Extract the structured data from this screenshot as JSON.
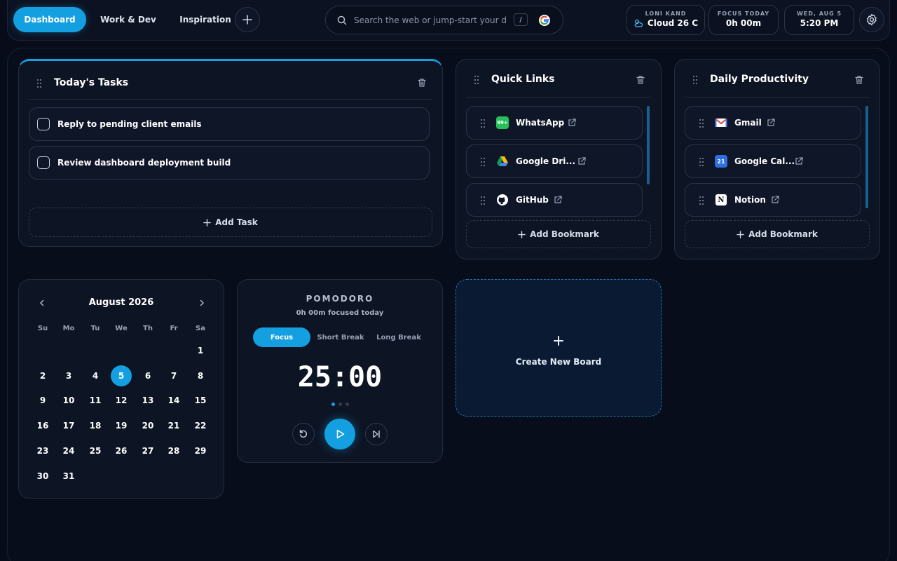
{
  "nav": {
    "tabs": [
      {
        "label": "Dashboard",
        "active": true
      },
      {
        "label": "Work & Dev",
        "active": false
      },
      {
        "label": "Inspiration",
        "active": false
      }
    ],
    "add_icon": "plus-icon"
  },
  "search": {
    "placeholder": "Search the web or jump-start your day",
    "shortcut": "/",
    "engine_icon": "google-icon"
  },
  "stats": {
    "weather": {
      "label": "LONI KAND",
      "value": "Cloud 26 C",
      "icon": "cloud-sun-icon"
    },
    "focus": {
      "label": "FOCUS TODAY",
      "value": "0h 00m"
    },
    "date": {
      "label": "WED, AUG 5",
      "value": "5:20 PM"
    }
  },
  "tasks": {
    "title": "Today's Tasks",
    "items": [
      {
        "text": "Reply to pending client emails",
        "done": false
      },
      {
        "text": "Review dashboard deployment build",
        "done": false
      }
    ],
    "add_label": "Add Task"
  },
  "quick_links": {
    "title": "Quick Links",
    "items": [
      {
        "name": "WhatsApp",
        "badge": "99+",
        "icon": "whatsapp-icon"
      },
      {
        "name": "Google Dri...",
        "icon": "google-drive-icon"
      },
      {
        "name": "GitHub",
        "icon": "github-icon"
      }
    ],
    "add_label": "Add Bookmark"
  },
  "daily": {
    "title": "Daily Productivity",
    "items": [
      {
        "name": "Gmail",
        "icon": "gmail-icon"
      },
      {
        "name": "Google Cal...",
        "badge": "21",
        "icon": "google-calendar-icon"
      },
      {
        "name": "Notion",
        "badge": "N",
        "icon": "notion-icon"
      }
    ],
    "add_label": "Add Bookmark"
  },
  "calendar": {
    "month": "August 2026",
    "weekdays": [
      "Su",
      "Mo",
      "Tu",
      "We",
      "Th",
      "Fr",
      "Sa"
    ],
    "selected_day": 5,
    "days": [
      "1",
      "2",
      "3",
      "4",
      "5",
      "6",
      "7",
      "8",
      "9",
      "10",
      "11",
      "12",
      "13",
      "14",
      "15",
      "16",
      "17",
      "18",
      "19",
      "20",
      "21",
      "22",
      "23",
      "24",
      "25",
      "26",
      "27",
      "28",
      "29",
      "30",
      "31"
    ],
    "first_weekday": 6
  },
  "pomodoro": {
    "title": "POMODORO",
    "subtitle": "0h 00m focused today",
    "modes": [
      {
        "label": "Focus",
        "active": true
      },
      {
        "label": "Short Break",
        "active": false
      },
      {
        "label": "Long Break",
        "active": false
      }
    ],
    "time": "25:00",
    "sessions_total": 3,
    "sessions_current": 1
  },
  "new_board": {
    "label": "Create New Board",
    "icon": "plus-icon"
  }
}
